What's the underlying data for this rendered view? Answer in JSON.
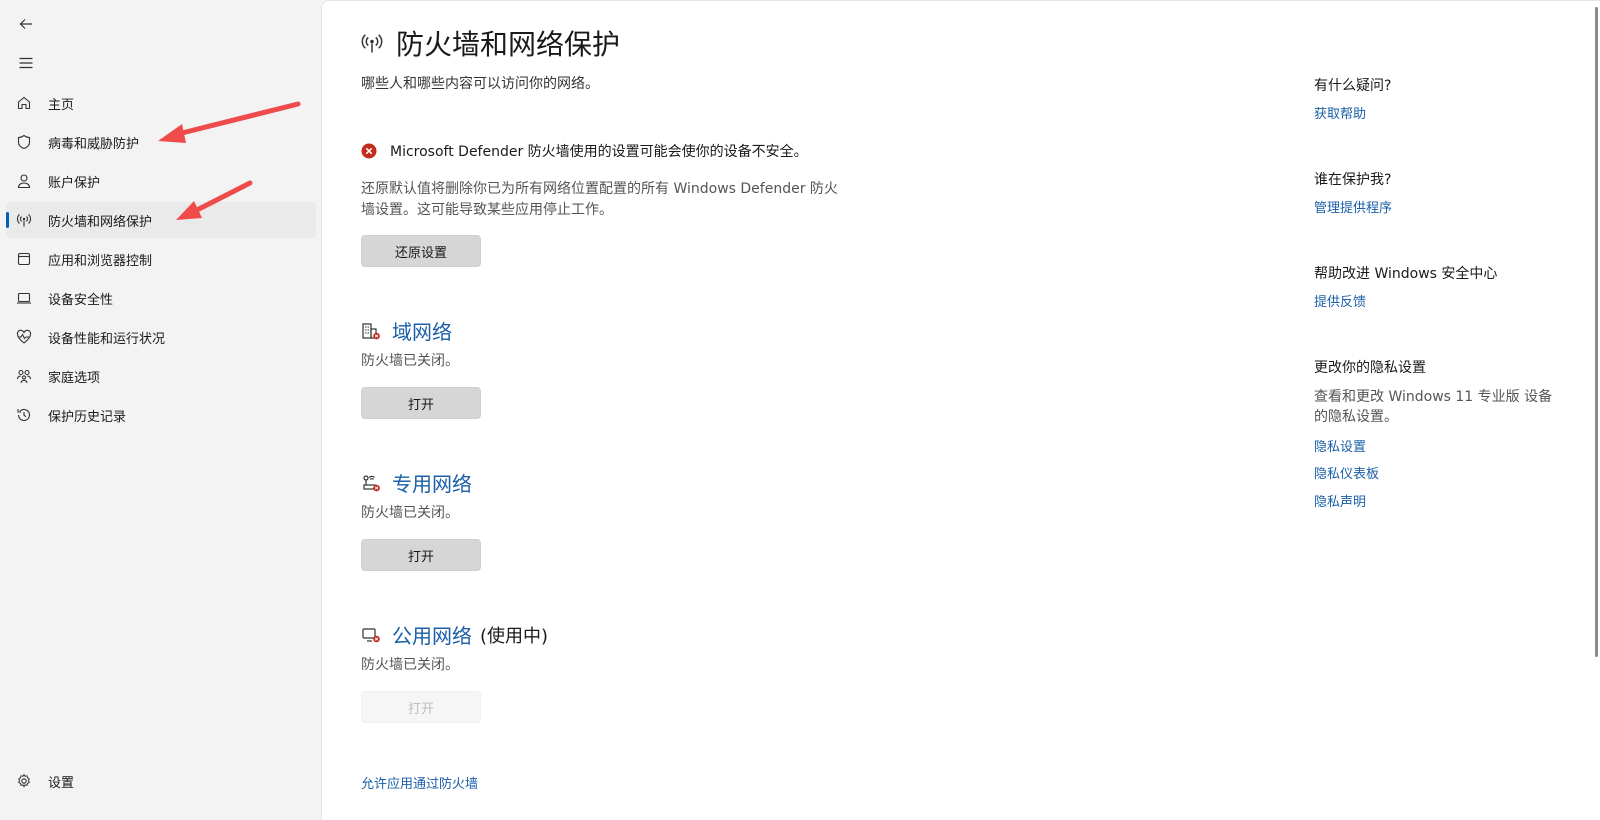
{
  "sidebar": {
    "back_icon": "back-arrow-icon",
    "menu_icon": "hamburger-menu-icon",
    "items": [
      {
        "label": "主页",
        "icon": "home-icon"
      },
      {
        "label": "病毒和威胁防护",
        "icon": "shield-icon"
      },
      {
        "label": "账户保护",
        "icon": "person-icon"
      },
      {
        "label": "防火墙和网络保护",
        "icon": "antenna-icon",
        "active": true
      },
      {
        "label": "应用和浏览器控制",
        "icon": "app-window-icon"
      },
      {
        "label": "设备安全性",
        "icon": "laptop-icon"
      },
      {
        "label": "设备性能和运行状况",
        "icon": "heartbeat-icon"
      },
      {
        "label": "家庭选项",
        "icon": "family-icon"
      },
      {
        "label": "保护历史记录",
        "icon": "history-icon"
      }
    ],
    "settings": {
      "label": "设置",
      "icon": "gear-icon"
    }
  },
  "main": {
    "title": "防火墙和网络保护",
    "description": "哪些人和哪些内容可以访问你的网络。",
    "warning": "Microsoft Defender 防火墙使用的设置可能会使你的设备不安全。",
    "restore_description": "还原默认值将删除你已为所有网络位置配置的所有 Windows Defender 防火墙设置。这可能导致某些应用停止工作。",
    "restore_button": "还原设置",
    "networks": [
      {
        "name": "域网络",
        "suffix": "",
        "status": "防火墙已关闭。",
        "button": "打开",
        "icon": "domain-network-icon",
        "enabled": true
      },
      {
        "name": "专用网络",
        "suffix": "",
        "status": "防火墙已关闭。",
        "button": "打开",
        "icon": "private-network-icon",
        "enabled": true
      },
      {
        "name": "公用网络",
        "suffix": "(使用中)",
        "status": "防火墙已关闭。",
        "button": "打开",
        "icon": "public-network-icon",
        "enabled": false
      }
    ],
    "allow_link": "允许应用通过防火墙"
  },
  "right_panel": {
    "questions_heading": "有什么疑问?",
    "get_help": "获取帮助",
    "protector_heading": "谁在保护我?",
    "manage_providers": "管理提供程序",
    "improve_heading": "帮助改进 Windows 安全中心",
    "give_feedback": "提供反馈",
    "privacy_heading": "更改你的隐私设置",
    "privacy_text": "查看和更改 Windows 11 专业版 设备的隐私设置。",
    "privacy_settings": "隐私设置",
    "privacy_dashboard": "隐私仪表板",
    "privacy_statement": "隐私声明"
  },
  "colors": {
    "accent": "#005fb8",
    "link": "#1a5fa8",
    "error": "#c42b1c",
    "annotation_arrow": "#ef4b4b"
  }
}
